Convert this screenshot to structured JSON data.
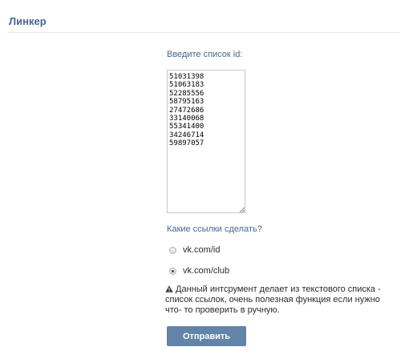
{
  "header": {
    "title": "Линкер"
  },
  "form": {
    "ids_label": "Введите список id:",
    "ids_value": "51031398\n51063183\n52285556\n58795163\n27472686\n33140068\n55341400\n34246714\n59897057",
    "links_label": "Какие ссылки сделать?",
    "options": [
      {
        "label": "vk.com/id",
        "checked": false
      },
      {
        "label": "vk.com/club",
        "checked": true
      }
    ],
    "info_icon": "warning-icon",
    "info_text": "Данный интсрумент делает из текстового списка - список ссылок, очень полезная функция если нужно что- то проверить в ручную.",
    "submit_label": "Отправить"
  },
  "colors": {
    "accent": "#45688e",
    "button": "#6383a8",
    "divider": "#e6e9ee"
  }
}
